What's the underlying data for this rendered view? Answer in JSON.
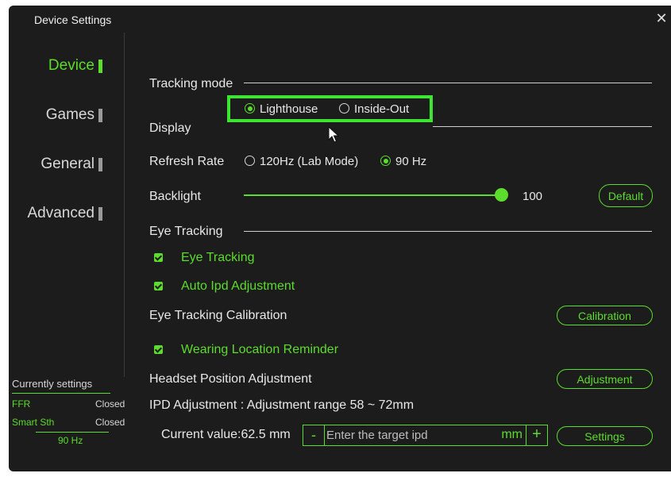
{
  "window": {
    "title": "Device Settings",
    "close_glyph": "✕"
  },
  "sidebar": {
    "items": [
      {
        "label": "Device",
        "active": true
      },
      {
        "label": "Games",
        "active": false
      },
      {
        "label": "General",
        "active": false
      },
      {
        "label": "Advanced",
        "active": false
      }
    ]
  },
  "current": {
    "title": "Currently settings",
    "ffr_label": "FFR",
    "ffr_value": "Closed",
    "smart_label": "Smart Sth",
    "smart_value": "Closed",
    "rate": "90 Hz"
  },
  "tracking": {
    "section": "Tracking mode",
    "options": [
      {
        "label": "Lighthouse",
        "selected": true
      },
      {
        "label": "Inside-Out",
        "selected": false
      }
    ]
  },
  "display": {
    "section": "Display",
    "refresh_label": "Refresh Rate",
    "refresh_options": [
      {
        "label": "120Hz (Lab Mode)",
        "selected": false
      },
      {
        "label": "90 Hz",
        "selected": true
      }
    ],
    "backlight_label": "Backlight",
    "backlight_value": "100",
    "backlight_fraction": 1.0,
    "default_button": "Default"
  },
  "eye": {
    "section": "Eye Tracking",
    "check_eye": "Eye Tracking",
    "check_auto": "Auto Ipd Adjustment",
    "calibration_label": "Eye Tracking Calibration",
    "calibration_button": "Calibration",
    "check_wearing": "Wearing Location Reminder",
    "headset_label": "Headset Position Adjustment",
    "adjustment_button": "Adjustment",
    "ipd_label": "IPD Adjustment : Adjustment range 58 ~ 72mm",
    "current_value": "Current value:62.5 mm",
    "ipd_placeholder": "Enter the target ipd",
    "ipd_unit": "mm",
    "minus": "-",
    "plus": "+",
    "settings_button": "Settings"
  },
  "colors": {
    "accent": "#5cdc2c",
    "highlight": "#3de532",
    "background": "#1c1c1c"
  },
  "icons": [
    "close-icon",
    "mouse-cursor-icon",
    "checkbox-checked-icon",
    "radio-selected-icon"
  ]
}
